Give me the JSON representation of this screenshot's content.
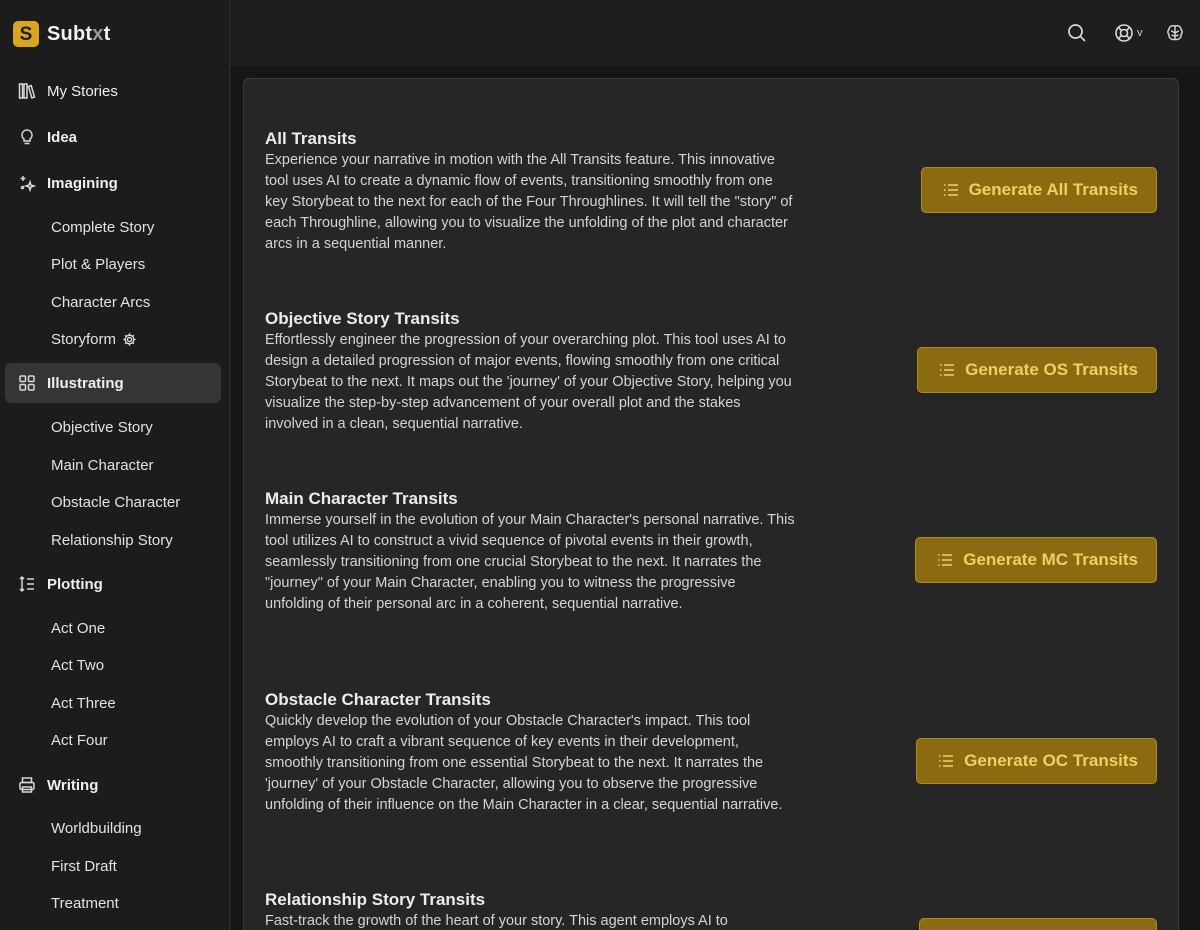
{
  "brand": {
    "logo_letter": "S",
    "name_pre": "Subt",
    "name_faded": "x",
    "name_post": "t",
    "accent": "#d9a521"
  },
  "sidebar": {
    "items": [
      {
        "id": "my-stories",
        "label": "My Stories",
        "icon": "books-icon",
        "bold": false
      },
      {
        "id": "idea",
        "label": "Idea",
        "icon": "lightbulb-icon",
        "bold": true
      },
      {
        "id": "imagining",
        "label": "Imagining",
        "icon": "sparkles-icon",
        "bold": true
      },
      {
        "id": "illustrating",
        "label": "Illustrating",
        "icon": "grid-icon",
        "bold": true,
        "active": true
      },
      {
        "id": "plotting",
        "label": "Plotting",
        "icon": "sort-list-icon",
        "bold": true
      },
      {
        "id": "writing",
        "label": "Writing",
        "icon": "printer-icon",
        "bold": true
      }
    ],
    "imagining_sub": [
      "Complete Story",
      "Plot & Players",
      "Character Arcs",
      "Storyform"
    ],
    "illustrating_sub": [
      "Objective Story",
      "Main Character",
      "Obstacle Character",
      "Relationship Story"
    ],
    "plotting_sub": [
      "Act One",
      "Act Two",
      "Act Three",
      "Act Four"
    ],
    "writing_sub": [
      "Worldbuilding",
      "First Draft",
      "Treatment"
    ]
  },
  "topbar": {
    "search_icon": "search-icon",
    "help_icon": "lifebuoy-icon",
    "caret": "v",
    "brain_icon": "brain-icon"
  },
  "sections": [
    {
      "title": "All Transits",
      "description": "Experience your narrative in motion with the All Transits feature. This innovative tool uses AI to create a dynamic flow of events, transitioning smoothly from one key Storybeat to the next for each of the Four Throughlines. It will tell the \"story\" of each Throughline, allowing you to visualize the unfolding of the plot and character arcs in a sequential manner.",
      "button": "Generate All Transits"
    },
    {
      "title": "Objective Story Transits",
      "description": "Effortlessly engineer the progression of your overarching plot. This tool uses AI to design a detailed progression of major events, flowing smoothly from one critical Storybeat to the next. It maps out the 'journey' of your Objective Story, helping you visualize the step-by-step advancement of your overall plot and the stakes involved in a clean, sequential narrative.",
      "button": "Generate OS Transits"
    },
    {
      "title": "Main Character Transits",
      "description": "Immerse yourself in the evolution of your Main Character's personal narrative. This tool utilizes AI to construct a vivid sequence of pivotal events in their growth, seamlessly transitioning from one crucial Storybeat to the next. It narrates the \"journey\" of your Main Character, enabling you to witness the progressive unfolding of their personal arc in a coherent, sequential narrative.",
      "button": "Generate MC Transits"
    },
    {
      "title": "Obstacle Character Transits",
      "description": "Quickly develop the evolution of your Obstacle Character's impact. This tool employs AI to craft a vibrant sequence of key events in their development, smoothly transitioning from one essential Storybeat to the next. It narrates the 'journey' of your Obstacle Character, allowing you to observe the progressive unfolding of their influence on the Main Character in a clear, sequential narrative.",
      "button": "Generate OC Transits"
    },
    {
      "title": "Relationship Story Transits",
      "description": "Fast-track the growth of the heart of your story. This agent employs AI to",
      "button": ""
    }
  ]
}
